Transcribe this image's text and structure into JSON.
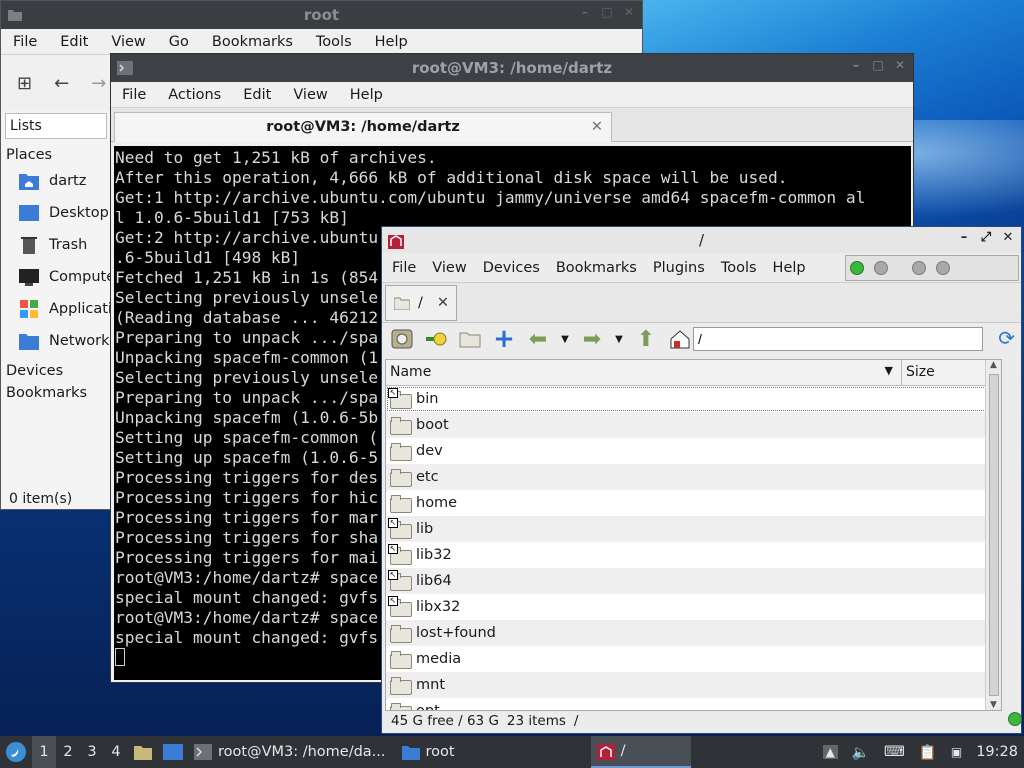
{
  "root_window": {
    "title": "root",
    "menu": [
      "File",
      "Edit",
      "View",
      "Go",
      "Bookmarks",
      "Tools",
      "Help"
    ],
    "lists_label": "Lists",
    "places_heading": "Places",
    "places": [
      {
        "label": "dartz",
        "icon": "home-folder-icon"
      },
      {
        "label": "Desktop",
        "icon": "desktop-icon"
      },
      {
        "label": "Trash",
        "icon": "trash-icon"
      },
      {
        "label": "Computer",
        "icon": "computer-icon"
      },
      {
        "label": "Applications",
        "icon": "applications-icon"
      },
      {
        "label": "Network",
        "icon": "network-icon"
      }
    ],
    "devices_heading": "Devices",
    "bookmarks_heading": "Bookmarks",
    "status": "0 item(s)"
  },
  "terminal": {
    "title": "root@VM3: /home/dartz",
    "menu": [
      "File",
      "Actions",
      "Edit",
      "View",
      "Help"
    ],
    "tab_title": "root@VM3: /home/dartz",
    "lines": [
      "Need to get 1,251 kB of archives.",
      "After this operation, 4,666 kB of additional disk space will be used.",
      "Get:1 http://archive.ubuntu.com/ubuntu jammy/universe amd64 spacefm-common al",
      "l 1.0.6-5build1 [753 kB]",
      "Get:2 http://archive.ubuntu",
      ".6-5build1 [498 kB]",
      "Fetched 1,251 kB in 1s (854",
      "Selecting previously unsele",
      "(Reading database ... 46212",
      "Preparing to unpack .../spa",
      "Unpacking spacefm-common (1",
      "Selecting previously unsele",
      "Preparing to unpack .../spa",
      "Unpacking spacefm (1.0.6-5b",
      "Setting up spacefm-common (",
      "Setting up spacefm (1.0.6-5",
      "Processing triggers for des",
      "Processing triggers for hic",
      "Processing triggers for mar",
      "Processing triggers for sha",
      "Processing triggers for mai",
      "root@VM3:/home/dartz# space",
      "special mount changed: gvfs",
      "root@VM3:/home/dartz# space",
      "special mount changed: gvfs"
    ]
  },
  "spacefm": {
    "title": "/",
    "menu": [
      "File",
      "View",
      "Devices",
      "Bookmarks",
      "Plugins",
      "Tools",
      "Help"
    ],
    "tab_label": "/",
    "path": "/",
    "columns": {
      "name": "Name",
      "size": "Size"
    },
    "items": [
      {
        "name": "bin",
        "link": true
      },
      {
        "name": "boot",
        "link": false
      },
      {
        "name": "dev",
        "link": false
      },
      {
        "name": "etc",
        "link": false
      },
      {
        "name": "home",
        "link": false
      },
      {
        "name": "lib",
        "link": true
      },
      {
        "name": "lib32",
        "link": true
      },
      {
        "name": "lib64",
        "link": true
      },
      {
        "name": "libx32",
        "link": true
      },
      {
        "name": "lost+found",
        "link": false
      },
      {
        "name": "media",
        "link": false
      },
      {
        "name": "mnt",
        "link": false
      },
      {
        "name": "opt",
        "link": false
      }
    ],
    "status_free": "45 G free / 63 G",
    "status_items": "23 items",
    "status_path": "/"
  },
  "taskbar": {
    "workspaces": [
      "1",
      "2",
      "3",
      "4"
    ],
    "tasks": [
      {
        "label": "root@VM3: /home/da...",
        "icon": "terminal-icon"
      },
      {
        "label": "root",
        "icon": "folder-icon"
      },
      {
        "label": "/",
        "icon": "spacefm-icon"
      }
    ],
    "clock": "19:28"
  }
}
